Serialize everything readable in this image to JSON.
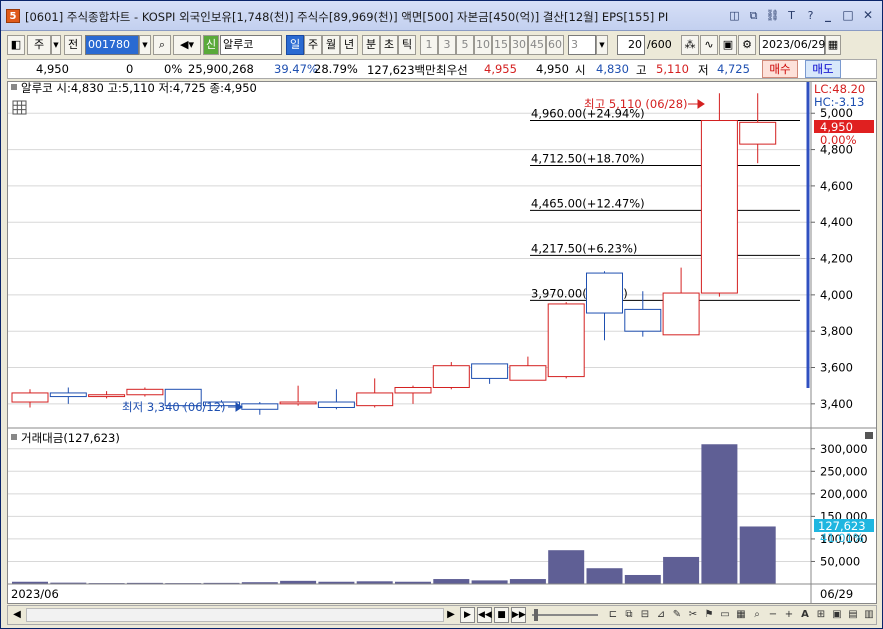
{
  "window": {
    "app_icon": "5",
    "title": "[0601] 주식종합차트 - KOSPI 외국인보유[1,748(천)] 주식수[89,969(천)] 액면[500] 자본금[450(억)] 결산[12월] EPS[155] PI",
    "icons": [
      "layout-icon",
      "copy-icon",
      "link-icon",
      "text-icon",
      "help-icon"
    ],
    "icon_glyphs": [
      "◫",
      "⧉",
      "⛓",
      "T",
      "?"
    ],
    "controls": [
      "_",
      "□",
      "✕"
    ]
  },
  "toolbar": {
    "period_main": "주",
    "prev_label": "전",
    "code": "001780",
    "badge": "신",
    "stock_name": "알루코",
    "periods": [
      "일",
      "주",
      "월",
      "년",
      "분",
      "초",
      "틱"
    ],
    "numbers": [
      "1",
      "3",
      "5",
      "10",
      "15",
      "30",
      "45",
      "60"
    ],
    "custom_n": "3",
    "count": "20",
    "count_total": "/600",
    "date": "2023/06/29"
  },
  "quote": {
    "price": "4,950",
    "change": "0",
    "change_pct": "0%",
    "volume": "25,900,268",
    "ratio1": "39.47%",
    "ratio2": "28.79%",
    "amount": "127,623백만",
    "best_label": "최우선",
    "best_ask": "4,955",
    "best_bid": "4,950",
    "open_label": "시",
    "open": "4,830",
    "high_label": "고",
    "high": "5,110",
    "low_label": "저",
    "low": "4,725",
    "buy_label": "매수",
    "sell_label": "매도"
  },
  "price_panel": {
    "legend": "알루코 시:4,830 고:5,110 저:4,725 종:4,950",
    "lc": "LC:48.20",
    "hc": "HC:-3.13",
    "current": "4,950",
    "current_pct": "0.00%",
    "high_note": "최고 5,110 (06/28)",
    "low_note": "최저 3,340 (06/12)",
    "fib_labels": [
      "4,960.00(+24.94%)",
      "4,712.50(+18.70%)",
      "4,465.00(+12.47%)",
      "4,217.50(+6.23%)",
      "3,970.00(0.00%)"
    ],
    "fib_values": [
      4960,
      4712.5,
      4465,
      4217.5,
      3970
    ],
    "axis_ticks": [
      "5,000",
      "4,800",
      "4,600",
      "4,400",
      "4,200",
      "4,000",
      "3,800",
      "3,600",
      "3,400"
    ],
    "axis_values": [
      5000,
      4800,
      4600,
      4400,
      4200,
      4000,
      3800,
      3600,
      3400
    ]
  },
  "volume_panel": {
    "legend": "거래대금(127,623)",
    "current": "127,623",
    "current_pct": "41.01%",
    "axis_ticks": [
      "300,000",
      "250,000",
      "200,000",
      "150,000",
      "100,000",
      "50,000"
    ],
    "axis_values": [
      300000,
      250000,
      200000,
      150000,
      100000,
      50000
    ]
  },
  "x_axis": {
    "start_label": "2023/06",
    "end_label": "06/29"
  },
  "colors": {
    "up": "#d42020",
    "down": "#1e4fb0",
    "volume_bar": "#5f5f95",
    "fib_line": "#000000",
    "price_box": "#e02020",
    "volume_box": "#1fb6e0"
  },
  "chart_data": {
    "type": "candlestick",
    "candles": [
      {
        "open": 3410,
        "high": 3480,
        "low": 3380,
        "close": 3460
      },
      {
        "open": 3460,
        "high": 3490,
        "low": 3400,
        "close": 3440
      },
      {
        "open": 3440,
        "high": 3470,
        "low": 3430,
        "close": 3450
      },
      {
        "open": 3450,
        "high": 3490,
        "low": 3440,
        "close": 3480
      },
      {
        "open": 3480,
        "high": 3480,
        "low": 3380,
        "close": 3390
      },
      {
        "open": 3410,
        "high": 3420,
        "low": 3380,
        "close": 3390
      },
      {
        "open": 3400,
        "high": 3410,
        "low": 3340,
        "close": 3370
      },
      {
        "open": 3400,
        "high": 3500,
        "low": 3390,
        "close": 3410
      },
      {
        "open": 3410,
        "high": 3480,
        "low": 3370,
        "close": 3380
      },
      {
        "open": 3390,
        "high": 3540,
        "low": 3380,
        "close": 3460
      },
      {
        "open": 3460,
        "high": 3500,
        "low": 3400,
        "close": 3490
      },
      {
        "open": 3490,
        "high": 3630,
        "low": 3480,
        "close": 3610
      },
      {
        "open": 3620,
        "high": 3620,
        "low": 3510,
        "close": 3540
      },
      {
        "open": 3530,
        "high": 3660,
        "low": 3530,
        "close": 3610
      },
      {
        "open": 3550,
        "high": 3960,
        "low": 3540,
        "close": 3950
      },
      {
        "open": 4120,
        "high": 4130,
        "low": 3750,
        "close": 3900
      },
      {
        "open": 3920,
        "high": 4020,
        "low": 3770,
        "close": 3800
      },
      {
        "open": 3780,
        "high": 4150,
        "low": 3780,
        "close": 4010
      },
      {
        "open": 4010,
        "high": 5110,
        "low": 3990,
        "close": 4960
      },
      {
        "open": 4830,
        "high": 5110,
        "low": 4725,
        "close": 4950
      }
    ],
    "volume_values": [
      5000,
      3000,
      2000,
      2500,
      2000,
      2500,
      4000,
      7000,
      5000,
      6000,
      5000,
      11000,
      8000,
      11000,
      75000,
      35000,
      20000,
      60000,
      310000,
      127623
    ],
    "ylim_price": [
      3300,
      5150
    ],
    "ylim_volume": [
      0,
      315000
    ]
  }
}
